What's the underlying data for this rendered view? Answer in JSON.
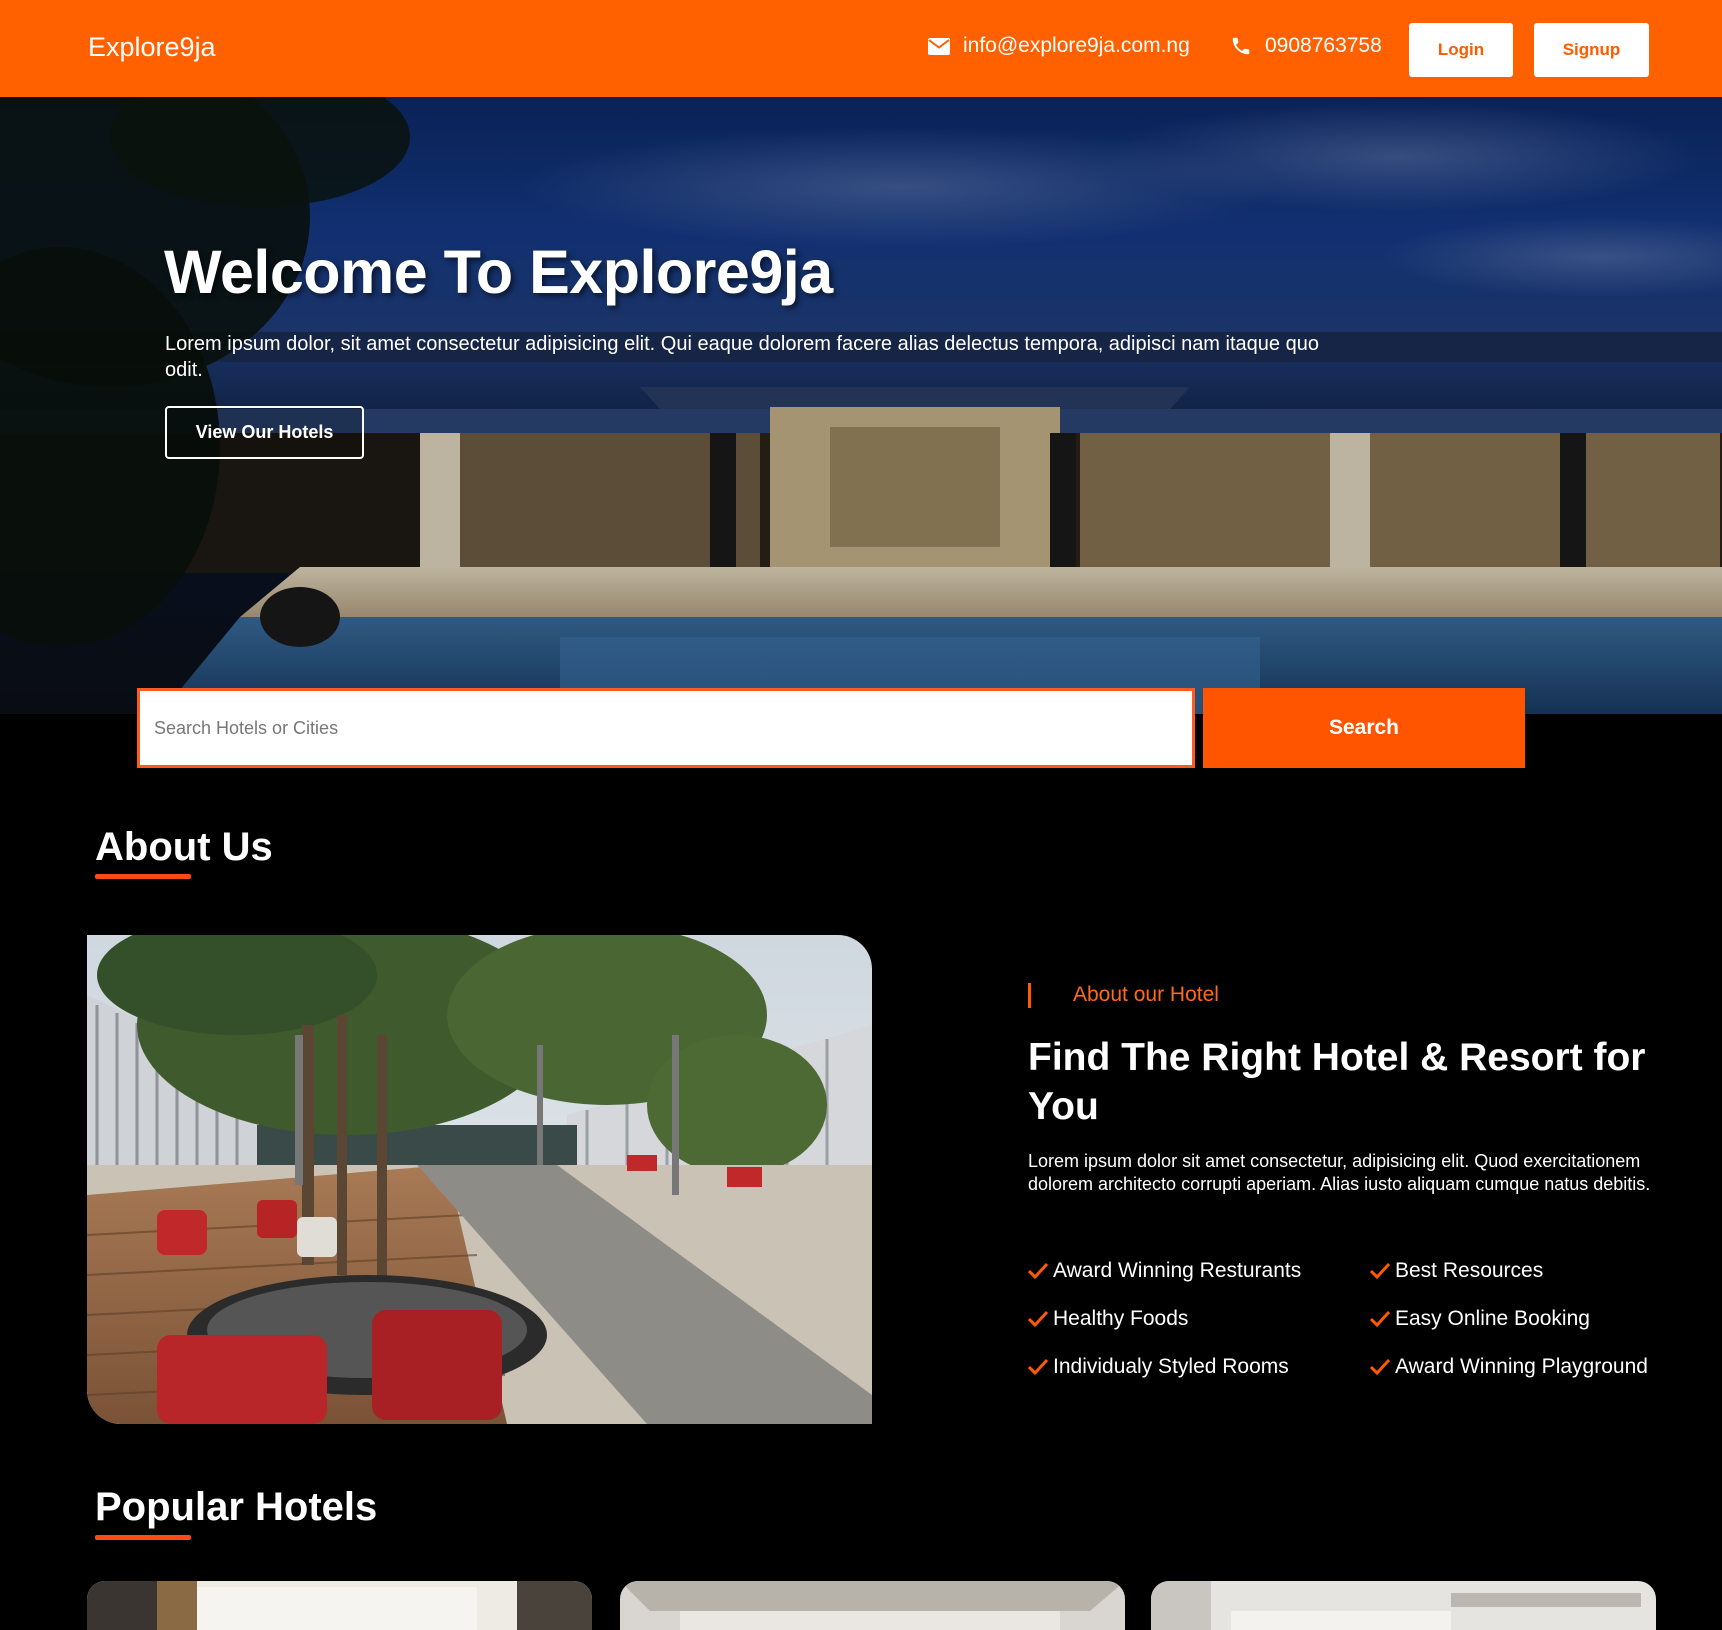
{
  "header": {
    "brand": "Explore9ja",
    "email": "info@explore9ja.com.ng",
    "phone": "0908763758",
    "login_label": "Login",
    "signup_label": "Signup"
  },
  "hero": {
    "title": "Welcome To Explore9ja",
    "text": "Lorem ipsum dolor, sit amet consectetur adipisicing elit. Qui eaque dolorem facere alias delectus tempora, adipisci nam itaque quo odit.",
    "button_label": "View Our Hotels"
  },
  "search": {
    "placeholder": "Search Hotels or Cities",
    "button_label": "Search"
  },
  "about": {
    "section_title": "About Us",
    "kicker": "About our Hotel",
    "heading": "Find The Right Hotel & Resort for You",
    "text": "Lorem ipsum dolor sit amet consectetur, adipisicing elit. Quod exercitationem dolorem architecto corrupti aperiam. Alias iusto aliquam cumque natus debitis.",
    "features": [
      "Award Winning Resturants",
      "Best Resources",
      "Healthy Foods",
      "Easy Online Booking",
      "Individualy Styled Rooms",
      "Award Winning Playground"
    ]
  },
  "popular": {
    "section_title": "Popular Hotels"
  },
  "colors": {
    "accent": "#ff6000",
    "background": "#000000"
  }
}
